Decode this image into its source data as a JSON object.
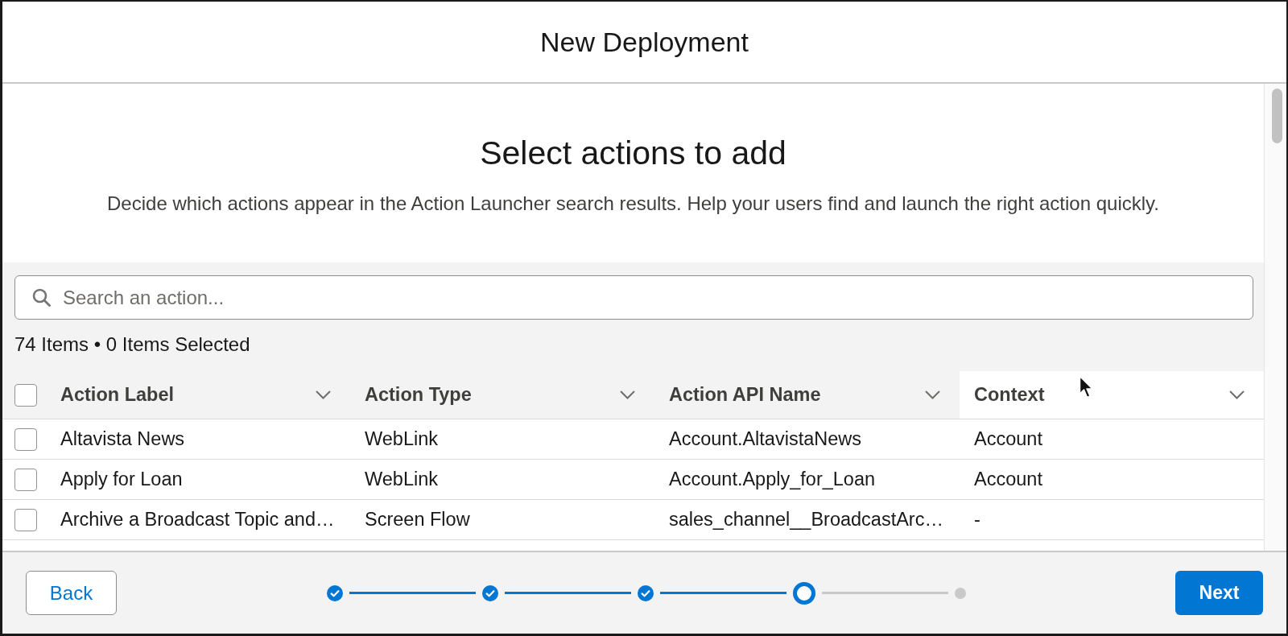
{
  "modal": {
    "title": "New Deployment"
  },
  "intro": {
    "heading": "Select actions to add",
    "description": "Decide which actions appear in the Action Launcher search results. Help your users find and launch the right action quickly."
  },
  "search": {
    "placeholder": "Search an action..."
  },
  "summary": "74 Items • 0 Items Selected",
  "table": {
    "select_all": {
      "checked": false
    },
    "columns": [
      {
        "label": "Action Label",
        "hovered": false
      },
      {
        "label": "Action Type",
        "hovered": false
      },
      {
        "label": "Action API Name",
        "hovered": false
      },
      {
        "label": "Context",
        "hovered": true
      }
    ],
    "rows": [
      {
        "selected": false,
        "cells": [
          "Altavista News",
          "WebLink",
          "Account.AltavistaNews",
          "Account"
        ]
      },
      {
        "selected": false,
        "cells": [
          "Apply for Loan",
          "WebLink",
          "Account.Apply_for_Loan",
          "Account"
        ]
      },
      {
        "selected": false,
        "cells": [
          "Archive a Broadcast Topic and…",
          "Screen Flow",
          "sales_channel__BroadcastArc…",
          "-"
        ]
      }
    ]
  },
  "footer": {
    "back": "Back",
    "next": "Next",
    "steps": [
      {
        "kind": "complete"
      },
      {
        "kind": "complete"
      },
      {
        "kind": "complete"
      },
      {
        "kind": "current"
      },
      {
        "kind": "upcoming"
      }
    ]
  }
}
